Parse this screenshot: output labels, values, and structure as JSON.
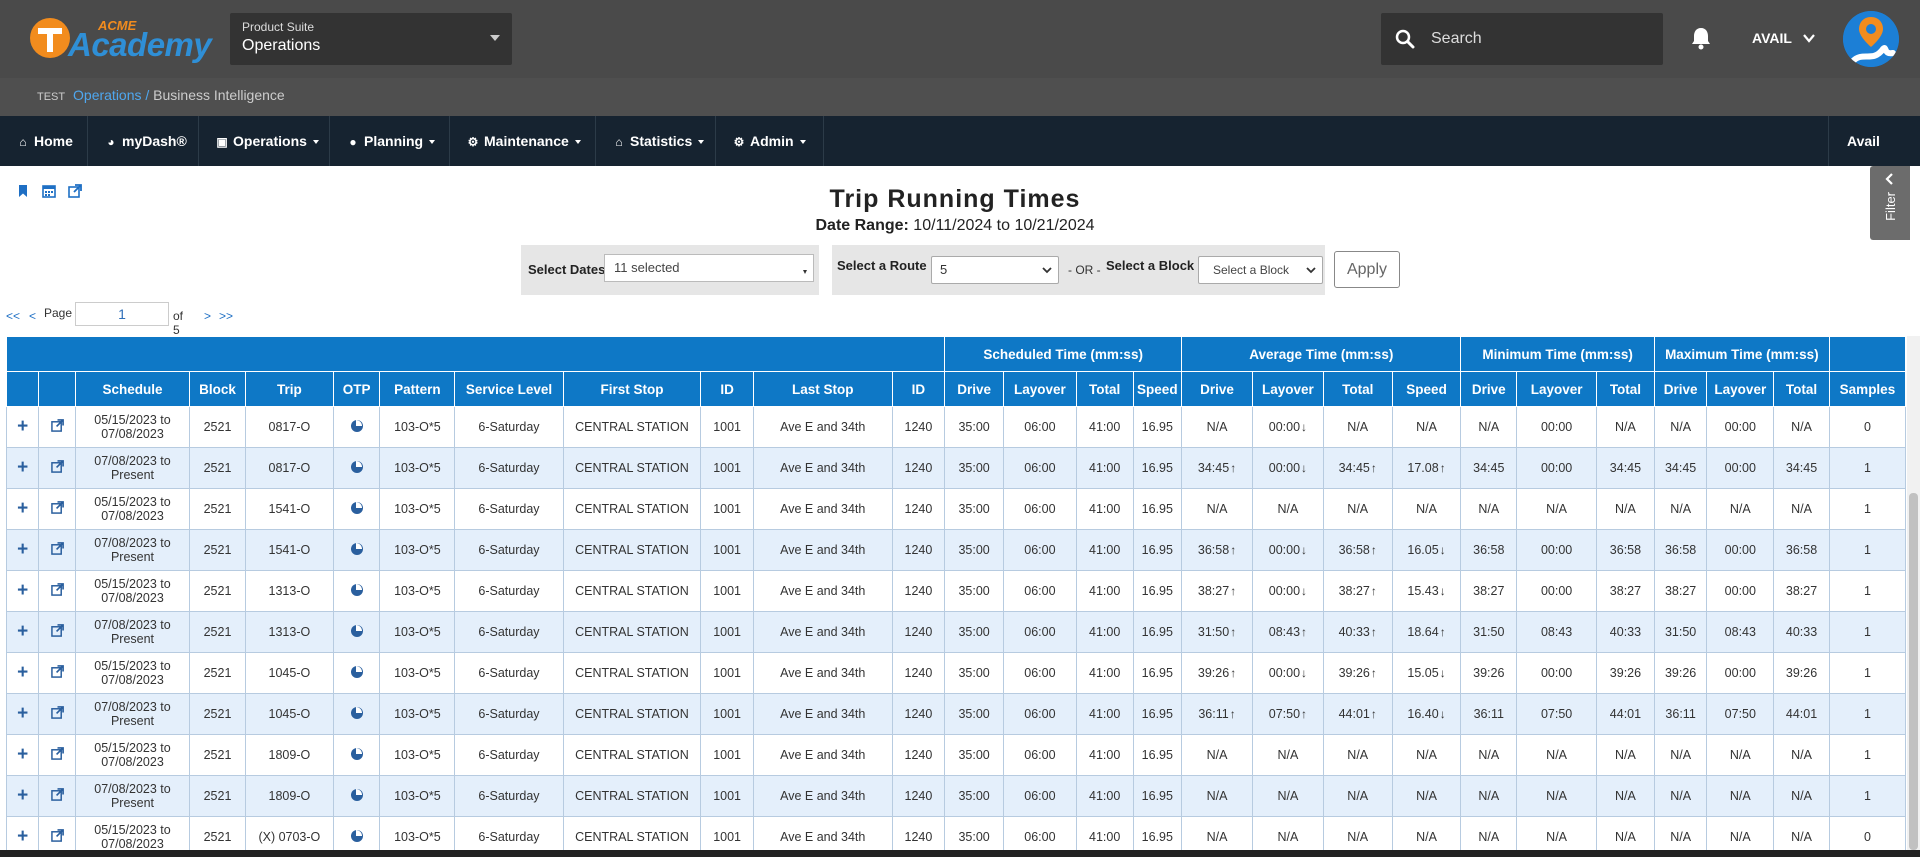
{
  "brand": {
    "acme": "ACME",
    "academy": "Academy"
  },
  "suite": {
    "label": "Product Suite",
    "value": "Operations"
  },
  "search": {
    "placeholder": "Search"
  },
  "user": {
    "name": "AVAIL"
  },
  "breadcrumb": {
    "env": "TEST",
    "parent": "Operations",
    "sep": "/",
    "current": "Business Intelligence"
  },
  "nav": {
    "items": [
      {
        "label": "Home",
        "icon": "home-icon"
      },
      {
        "label": "myDash®",
        "icon": "dashboard-icon"
      },
      {
        "label": "Operations",
        "icon": "bus-icon"
      },
      {
        "label": "Planning",
        "icon": "map-marker-icon"
      },
      {
        "label": "Maintenance",
        "icon": "wrench-icon"
      },
      {
        "label": "Statistics",
        "icon": "bank-icon"
      },
      {
        "label": "Admin",
        "icon": "cogs-icon"
      }
    ],
    "right": "Avail"
  },
  "page": {
    "title": "Trip Running Times",
    "date_range_label": "Date Range:",
    "date_from": "10/11/2024",
    "date_to_word": "to",
    "date_to": "10/21/2024"
  },
  "filters": {
    "dates_label": "Select Dates",
    "dates_value": "11 selected",
    "route_label": "Select a Route",
    "route_value": "5",
    "or_text": "- OR -",
    "block_label": "Select a Block",
    "block_placeholder": "Select a Block",
    "apply": "Apply"
  },
  "filter_tab": "Filter",
  "pager": {
    "first": "<<",
    "prev": "<",
    "page_label": "Page",
    "page": "1",
    "of_text": "of 5",
    "next": ">",
    "last": ">>"
  },
  "table": {
    "groups": [
      "Scheduled Time (mm:ss)",
      "Average Time (mm:ss)",
      "Minimum Time (mm:ss)",
      "Maximum Time (mm:ss)"
    ],
    "columns": [
      "Schedule",
      "Block",
      "Trip",
      "OTP",
      "Pattern",
      "Service Level",
      "First Stop",
      "ID",
      "Last Stop",
      "ID",
      "Drive",
      "Layover",
      "Total",
      "Speed",
      "Drive",
      "Layover",
      "Total",
      "Speed",
      "Drive",
      "Layover",
      "Total",
      "Drive",
      "Layover",
      "Total",
      "Samples"
    ],
    "rows": [
      {
        "schedule": [
          "05/15/2023 to",
          "07/08/2023"
        ],
        "block": "2521",
        "trip": "0817-O",
        "pattern": "103-O*5",
        "service": "6-Saturday",
        "first": "CENTRAL STATION",
        "first_id": "1001",
        "last": "Ave E and 34th",
        "last_id": "1240",
        "sched": [
          "35:00",
          "06:00",
          "41:00",
          "16.95"
        ],
        "avg": [
          {
            "v": "N/A",
            "a": ""
          },
          {
            "v": "00:00",
            "a": "down"
          },
          {
            "v": "N/A",
            "a": ""
          },
          {
            "v": "N/A",
            "a": ""
          }
        ],
        "min": [
          "N/A",
          "00:00",
          "N/A"
        ],
        "max": [
          "N/A",
          "00:00",
          "N/A"
        ],
        "samples": "0"
      },
      {
        "schedule": [
          "07/08/2023 to",
          "Present"
        ],
        "block": "2521",
        "trip": "0817-O",
        "pattern": "103-O*5",
        "service": "6-Saturday",
        "first": "CENTRAL STATION",
        "first_id": "1001",
        "last": "Ave E and 34th",
        "last_id": "1240",
        "sched": [
          "35:00",
          "06:00",
          "41:00",
          "16.95"
        ],
        "avg": [
          {
            "v": "34:45",
            "a": "up"
          },
          {
            "v": "00:00",
            "a": "down"
          },
          {
            "v": "34:45",
            "a": "up"
          },
          {
            "v": "17.08",
            "a": "up"
          }
        ],
        "min": [
          "34:45",
          "00:00",
          "34:45"
        ],
        "max": [
          "34:45",
          "00:00",
          "34:45"
        ],
        "samples": "1"
      },
      {
        "schedule": [
          "05/15/2023 to",
          "07/08/2023"
        ],
        "block": "2521",
        "trip": "1541-O",
        "pattern": "103-O*5",
        "service": "6-Saturday",
        "first": "CENTRAL STATION",
        "first_id": "1001",
        "last": "Ave E and 34th",
        "last_id": "1240",
        "sched": [
          "35:00",
          "06:00",
          "41:00",
          "16.95"
        ],
        "avg": [
          {
            "v": "N/A",
            "a": ""
          },
          {
            "v": "N/A",
            "a": ""
          },
          {
            "v": "N/A",
            "a": ""
          },
          {
            "v": "N/A",
            "a": ""
          }
        ],
        "min": [
          "N/A",
          "N/A",
          "N/A"
        ],
        "max": [
          "N/A",
          "N/A",
          "N/A"
        ],
        "samples": "1"
      },
      {
        "schedule": [
          "07/08/2023 to",
          "Present"
        ],
        "block": "2521",
        "trip": "1541-O",
        "pattern": "103-O*5",
        "service": "6-Saturday",
        "first": "CENTRAL STATION",
        "first_id": "1001",
        "last": "Ave E and 34th",
        "last_id": "1240",
        "sched": [
          "35:00",
          "06:00",
          "41:00",
          "16.95"
        ],
        "avg": [
          {
            "v": "36:58",
            "a": "up"
          },
          {
            "v": "00:00",
            "a": "down"
          },
          {
            "v": "36:58",
            "a": "up"
          },
          {
            "v": "16.05",
            "a": "down"
          }
        ],
        "min": [
          "36:58",
          "00:00",
          "36:58"
        ],
        "max": [
          "36:58",
          "00:00",
          "36:58"
        ],
        "samples": "1"
      },
      {
        "schedule": [
          "05/15/2023 to",
          "07/08/2023"
        ],
        "block": "2521",
        "trip": "1313-O",
        "pattern": "103-O*5",
        "service": "6-Saturday",
        "first": "CENTRAL STATION",
        "first_id": "1001",
        "last": "Ave E and 34th",
        "last_id": "1240",
        "sched": [
          "35:00",
          "06:00",
          "41:00",
          "16.95"
        ],
        "avg": [
          {
            "v": "38:27",
            "a": "up"
          },
          {
            "v": "00:00",
            "a": "down"
          },
          {
            "v": "38:27",
            "a": "up"
          },
          {
            "v": "15.43",
            "a": "down"
          }
        ],
        "min": [
          "38:27",
          "00:00",
          "38:27"
        ],
        "max": [
          "38:27",
          "00:00",
          "38:27"
        ],
        "samples": "1"
      },
      {
        "schedule": [
          "07/08/2023 to",
          "Present"
        ],
        "block": "2521",
        "trip": "1313-O",
        "pattern": "103-O*5",
        "service": "6-Saturday",
        "first": "CENTRAL STATION",
        "first_id": "1001",
        "last": "Ave E and 34th",
        "last_id": "1240",
        "sched": [
          "35:00",
          "06:00",
          "41:00",
          "16.95"
        ],
        "avg": [
          {
            "v": "31:50",
            "a": "up"
          },
          {
            "v": "08:43",
            "a": "up"
          },
          {
            "v": "40:33",
            "a": "up"
          },
          {
            "v": "18.64",
            "a": "up"
          }
        ],
        "min": [
          "31:50",
          "08:43",
          "40:33"
        ],
        "max": [
          "31:50",
          "08:43",
          "40:33"
        ],
        "samples": "1"
      },
      {
        "schedule": [
          "05/15/2023 to",
          "07/08/2023"
        ],
        "block": "2521",
        "trip": "1045-O",
        "pattern": "103-O*5",
        "service": "6-Saturday",
        "first": "CENTRAL STATION",
        "first_id": "1001",
        "last": "Ave E and 34th",
        "last_id": "1240",
        "sched": [
          "35:00",
          "06:00",
          "41:00",
          "16.95"
        ],
        "avg": [
          {
            "v": "39:26",
            "a": "up"
          },
          {
            "v": "00:00",
            "a": "down"
          },
          {
            "v": "39:26",
            "a": "up"
          },
          {
            "v": "15.05",
            "a": "down"
          }
        ],
        "min": [
          "39:26",
          "00:00",
          "39:26"
        ],
        "max": [
          "39:26",
          "00:00",
          "39:26"
        ],
        "samples": "1"
      },
      {
        "schedule": [
          "07/08/2023 to",
          "Present"
        ],
        "block": "2521",
        "trip": "1045-O",
        "pattern": "103-O*5",
        "service": "6-Saturday",
        "first": "CENTRAL STATION",
        "first_id": "1001",
        "last": "Ave E and 34th",
        "last_id": "1240",
        "sched": [
          "35:00",
          "06:00",
          "41:00",
          "16.95"
        ],
        "avg": [
          {
            "v": "36:11",
            "a": "up"
          },
          {
            "v": "07:50",
            "a": "up"
          },
          {
            "v": "44:01",
            "a": "up"
          },
          {
            "v": "16.40",
            "a": "down"
          }
        ],
        "min": [
          "36:11",
          "07:50",
          "44:01"
        ],
        "max": [
          "36:11",
          "07:50",
          "44:01"
        ],
        "samples": "1"
      },
      {
        "schedule": [
          "05/15/2023 to",
          "07/08/2023"
        ],
        "block": "2521",
        "trip": "1809-O",
        "pattern": "103-O*5",
        "service": "6-Saturday",
        "first": "CENTRAL STATION",
        "first_id": "1001",
        "last": "Ave E and 34th",
        "last_id": "1240",
        "sched": [
          "35:00",
          "06:00",
          "41:00",
          "16.95"
        ],
        "avg": [
          {
            "v": "N/A",
            "a": ""
          },
          {
            "v": "N/A",
            "a": ""
          },
          {
            "v": "N/A",
            "a": ""
          },
          {
            "v": "N/A",
            "a": ""
          }
        ],
        "min": [
          "N/A",
          "N/A",
          "N/A"
        ],
        "max": [
          "N/A",
          "N/A",
          "N/A"
        ],
        "samples": "1"
      },
      {
        "schedule": [
          "07/08/2023 to",
          "Present"
        ],
        "block": "2521",
        "trip": "1809-O",
        "pattern": "103-O*5",
        "service": "6-Saturday",
        "first": "CENTRAL STATION",
        "first_id": "1001",
        "last": "Ave E and 34th",
        "last_id": "1240",
        "sched": [
          "35:00",
          "06:00",
          "41:00",
          "16.95"
        ],
        "avg": [
          {
            "v": "N/A",
            "a": ""
          },
          {
            "v": "N/A",
            "a": ""
          },
          {
            "v": "N/A",
            "a": ""
          },
          {
            "v": "N/A",
            "a": ""
          }
        ],
        "min": [
          "N/A",
          "N/A",
          "N/A"
        ],
        "max": [
          "N/A",
          "N/A",
          "N/A"
        ],
        "samples": "1"
      },
      {
        "schedule": [
          "05/15/2023 to",
          "07/08/2023"
        ],
        "block": "2521",
        "trip": "(X) 0703-O",
        "pattern": "103-O*5",
        "service": "6-Saturday",
        "first": "CENTRAL STATION",
        "first_id": "1001",
        "last": "Ave E and 34th",
        "last_id": "1240",
        "sched": [
          "35:00",
          "06:00",
          "41:00",
          "16.95"
        ],
        "avg": [
          {
            "v": "N/A",
            "a": ""
          },
          {
            "v": "N/A",
            "a": ""
          },
          {
            "v": "N/A",
            "a": ""
          },
          {
            "v": "N/A",
            "a": ""
          }
        ],
        "min": [
          "N/A",
          "N/A",
          "N/A"
        ],
        "max": [
          "N/A",
          "N/A",
          "N/A"
        ],
        "samples": "0"
      }
    ]
  },
  "colors": {
    "header_blue": "#0e78c6",
    "nav_dark": "#162330",
    "top_gray": "#4a4a4a",
    "brand_orange": "#f28c1e",
    "row_alt": "#e4effb"
  }
}
